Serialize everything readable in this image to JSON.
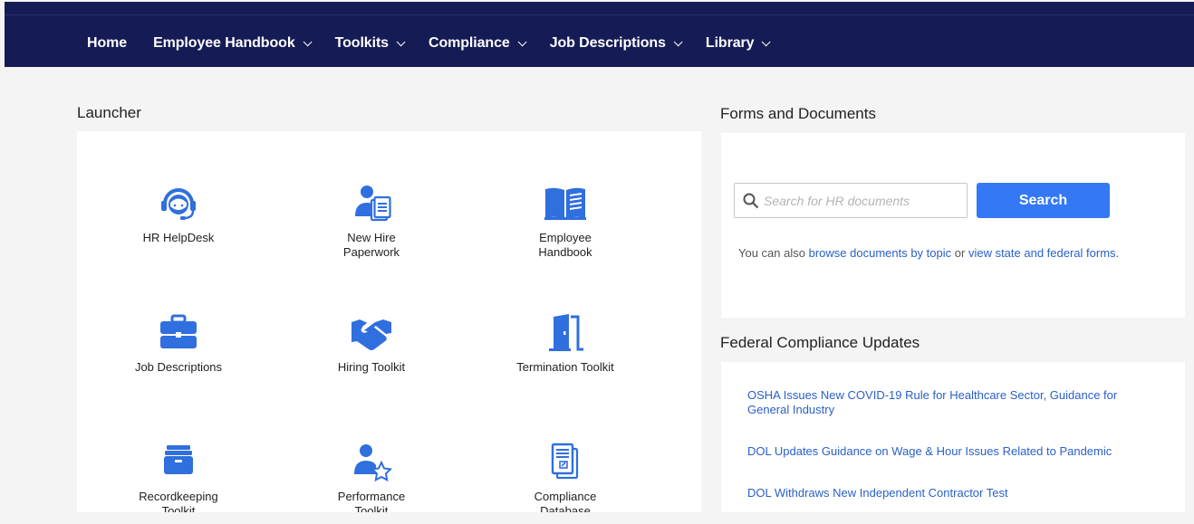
{
  "nav": {
    "items": [
      {
        "label": "Home",
        "has_dropdown": false
      },
      {
        "label": "Employee Handbook",
        "has_dropdown": true
      },
      {
        "label": "Toolkits",
        "has_dropdown": true
      },
      {
        "label": "Compliance",
        "has_dropdown": true
      },
      {
        "label": "Job Descriptions",
        "has_dropdown": true
      },
      {
        "label": "Library",
        "has_dropdown": true
      }
    ]
  },
  "launcher": {
    "title": "Launcher",
    "tiles": [
      {
        "label": "HR HelpDesk",
        "icon": "headset-icon"
      },
      {
        "label": "New Hire Paperwork",
        "icon": "new-hire-icon"
      },
      {
        "label": "Employee Handbook",
        "icon": "book-icon"
      },
      {
        "label": "Job Descriptions",
        "icon": "briefcase-icon"
      },
      {
        "label": "Hiring Toolkit",
        "icon": "handshake-icon"
      },
      {
        "label": "Termination Toolkit",
        "icon": "door-icon"
      },
      {
        "label": "Recordkeeping Toolkit",
        "icon": "file-box-icon"
      },
      {
        "label": "Performance Toolkit",
        "icon": "user-star-icon"
      },
      {
        "label": "Compliance Database",
        "icon": "documents-icon"
      }
    ]
  },
  "forms": {
    "title": "Forms and Documents",
    "search_placeholder": "Search for HR documents",
    "search_button": "Search",
    "browse_prefix": "You can also",
    "browse_link": "browse documents by topic",
    "browse_or": "or",
    "state_link": "view state and federal forms",
    "browse_suffix": "."
  },
  "federal": {
    "title": "Federal Compliance Updates",
    "links": [
      "OSHA Issues New COVID-19 Rule for Healthcare Sector, Guidance for General Industry",
      "DOL Updates Guidance on Wage & Hour Issues Related to Pandemic",
      "DOL Withdraws New Independent Contractor Test"
    ]
  },
  "colors": {
    "nav_bg": "#151b54",
    "accent": "#3478f6",
    "icon": "#2f6fde",
    "link": "#2a60c9"
  }
}
